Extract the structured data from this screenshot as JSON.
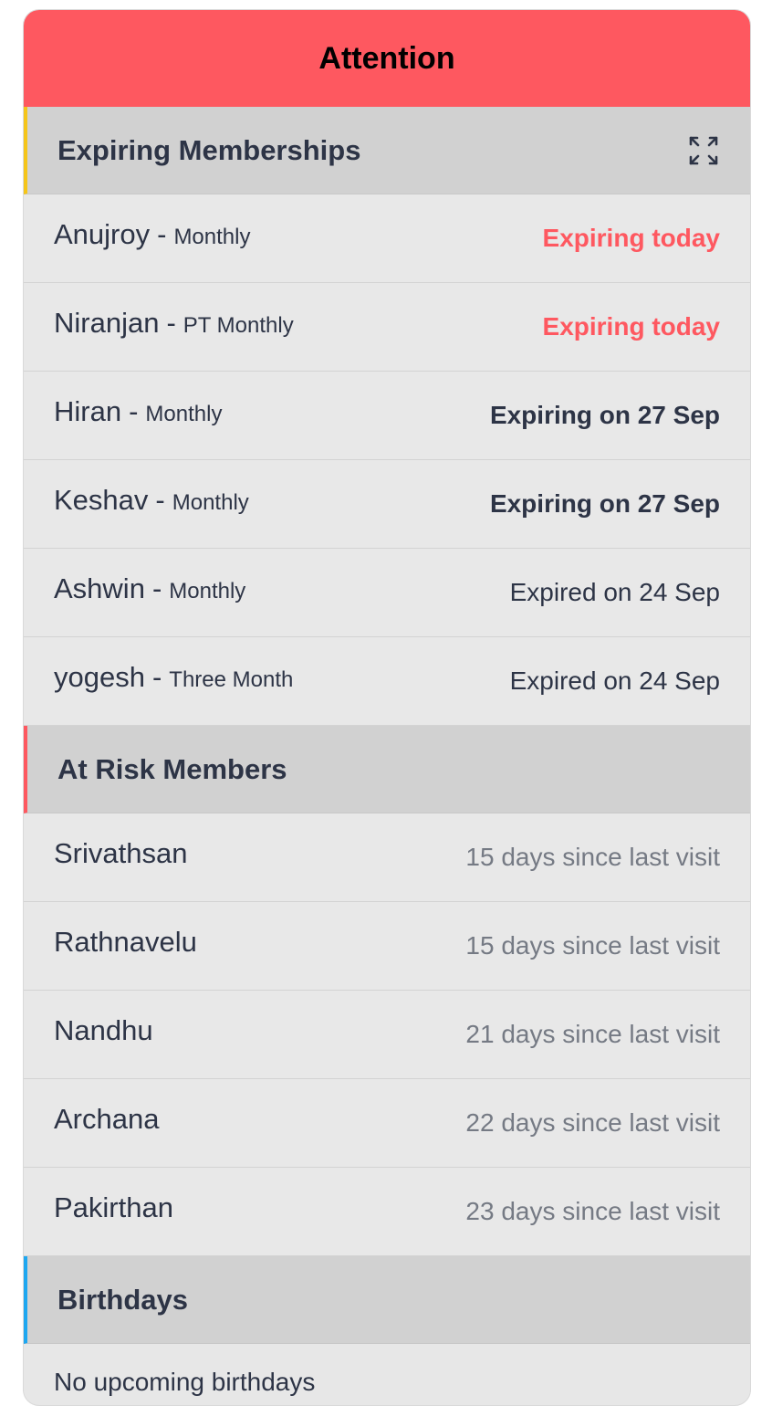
{
  "card": {
    "title": "Attention"
  },
  "expiring": {
    "title": "Expiring Memberships",
    "expand_icon": "expand-icon",
    "items": [
      {
        "name": "Anujroy",
        "plan": "Monthly",
        "status": "Expiring today",
        "kind": "today"
      },
      {
        "name": "Niranjan",
        "plan": "PT Monthly",
        "status": "Expiring today",
        "kind": "today"
      },
      {
        "name": "Hiran",
        "plan": "Monthly",
        "status": "Expiring on 27 Sep",
        "kind": "soon"
      },
      {
        "name": "Keshav",
        "plan": "Monthly",
        "status": "Expiring on 27 Sep",
        "kind": "soon"
      },
      {
        "name": "Ashwin",
        "plan": "Monthly",
        "status": "Expired on 24 Sep",
        "kind": "expired"
      },
      {
        "name": "yogesh",
        "plan": "Three Month",
        "status": "Expired on 24 Sep",
        "kind": "expired"
      }
    ]
  },
  "at_risk": {
    "title": "At Risk Members",
    "items": [
      {
        "name": "Srivathsan",
        "status": "15 days since last visit"
      },
      {
        "name": "Rathnavelu",
        "status": "15 days since last visit"
      },
      {
        "name": "Nandhu",
        "status": "21 days since last visit"
      },
      {
        "name": "Archana",
        "status": "22 days since last visit"
      },
      {
        "name": "Pakirthan",
        "status": "23 days since last visit"
      }
    ]
  },
  "birthdays": {
    "title": "Birthdays",
    "empty_text": "No upcoming birthdays"
  },
  "colors": {
    "header": "#fe5860",
    "expiring_accent": "#f5c518",
    "at_risk_accent": "#fe5860",
    "birthdays_accent": "#1ea7f0",
    "text": "#2d3446",
    "muted": "#757a84"
  },
  "separator": "-"
}
